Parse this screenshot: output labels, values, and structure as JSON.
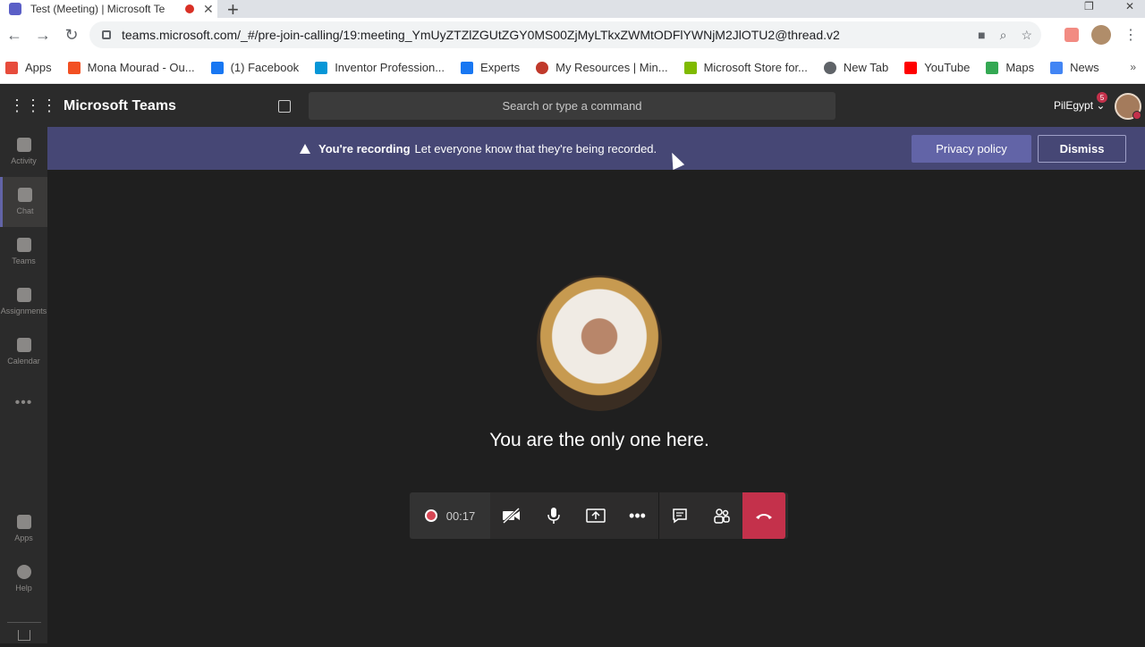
{
  "browser": {
    "tab_title": "Test (Meeting) | Microsoft Te",
    "tab_close": "✕",
    "new_tab": "+",
    "url": "teams.microsoft.com/_#/pre-join-calling/19:meeting_YmUyZTZlZGUtZGY0MS00ZjMyLTkxZWMtODFlYWNjM2JlOTU2@thread.v2",
    "bookmarks": [
      {
        "label": "Apps",
        "color": "#e74c3c"
      },
      {
        "label": "Mona Mourad - Ou...",
        "color": "#f25022"
      },
      {
        "label": "(1) Facebook",
        "color": "#1877f2"
      },
      {
        "label": "Inventor Profession...",
        "color": "#0696d7"
      },
      {
        "label": "Experts",
        "color": "#1877f2"
      },
      {
        "label": "My Resources | Min...",
        "color": "#c0392b"
      },
      {
        "label": "Microsoft Store for...",
        "color": "#7fba00"
      },
      {
        "label": "New Tab",
        "color": "#5f6368"
      },
      {
        "label": "YouTube",
        "color": "#ff0000"
      },
      {
        "label": "Maps",
        "color": "#34a853"
      },
      {
        "label": "News",
        "color": "#4285f4"
      }
    ],
    "bookmarks_more": "»"
  },
  "teams": {
    "app_name": "Microsoft Teams",
    "search_placeholder": "Search or type a command",
    "tenant": "PilEgypt ⌄",
    "tenant_badge": "5",
    "rail": [
      {
        "label": "Activity"
      },
      {
        "label": "Chat"
      },
      {
        "label": "Teams"
      },
      {
        "label": "Assignments"
      },
      {
        "label": "Calendar"
      },
      {
        "label": "Apps"
      },
      {
        "label": "Help"
      }
    ],
    "rail_more": "•••",
    "banner": {
      "title": "You're recording",
      "message": "Let everyone know that they're being recorded.",
      "privacy_button": "Privacy policy",
      "dismiss_button": "Dismiss"
    },
    "stage": {
      "only_one_text": "You are the only one here."
    },
    "controls": {
      "timer": "00:17",
      "more": "•••"
    }
  },
  "colors": {
    "accent": "#6264a7",
    "banner_bg": "#464775",
    "hangup": "#c4314b"
  }
}
